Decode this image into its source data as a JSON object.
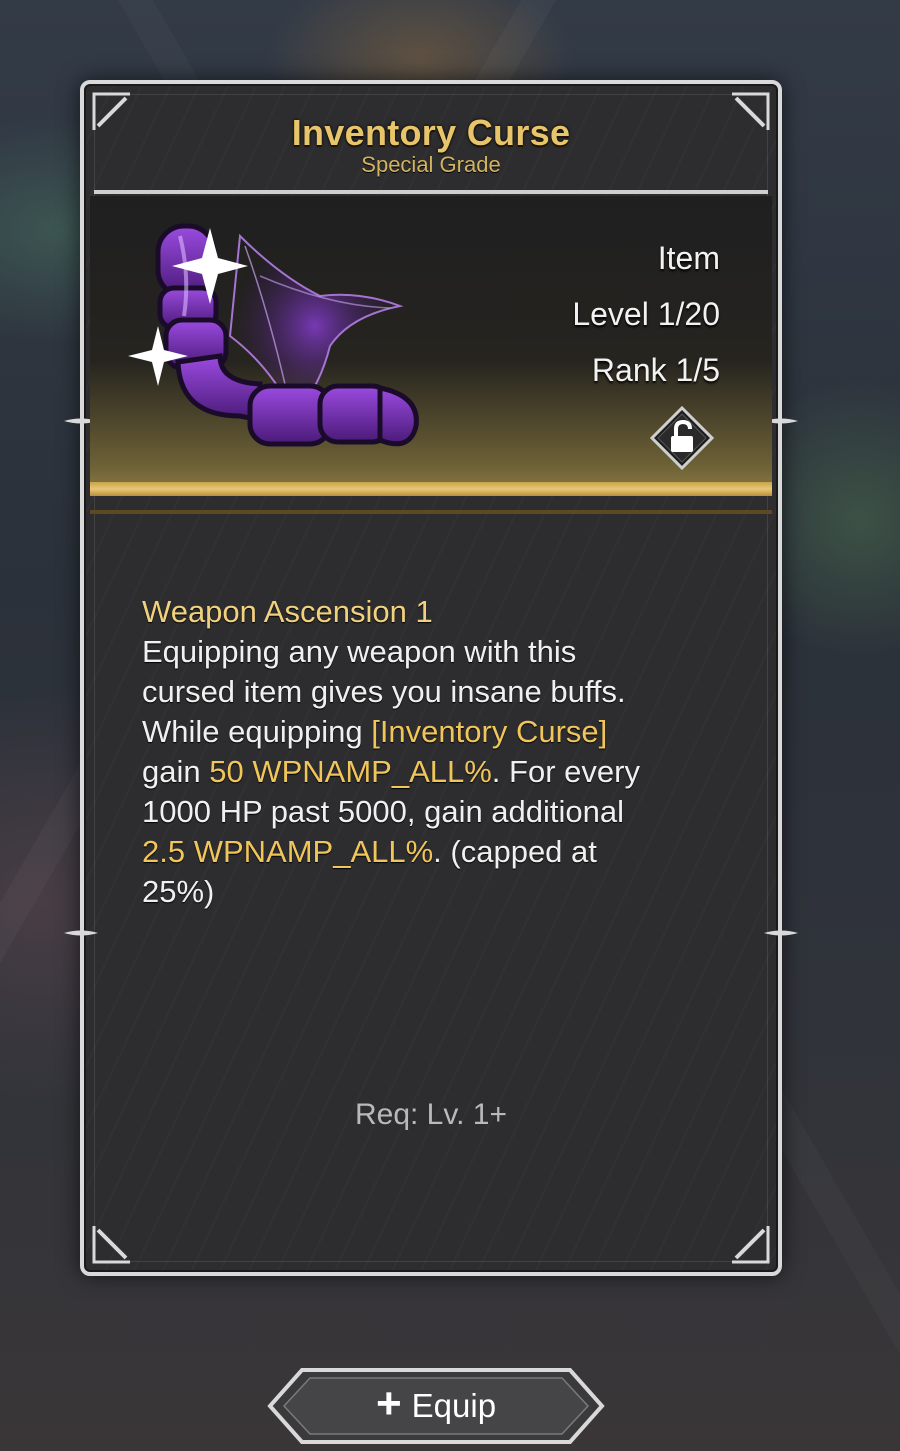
{
  "item": {
    "name": "Inventory Curse",
    "grade": "Special Grade",
    "type": "Item",
    "level": "Level 1/20",
    "rank": "Rank 1/5",
    "lock_icon": "unlocked-padlock-icon"
  },
  "description": {
    "title": "Weapon Ascension 1",
    "line1": "Equipping any weapon with this",
    "line2": "cursed item gives you insane buffs.",
    "line3_pre": "While equipping ",
    "line3_hl": "[Inventory Curse]",
    "line4_pre": "gain ",
    "line4_hl": "50 WPNAMP_ALL%",
    "line4_post": ". For every",
    "line5": "1000 HP past 5000, gain additional",
    "line6_hl": "2.5 WPNAMP_ALL%",
    "line6_post": ". (capped at",
    "line7": "25%)"
  },
  "requirement": "Req: Lv. 1+",
  "equip_button": {
    "icon": "plus-icon",
    "label": "Equip"
  },
  "colors": {
    "title_gold": "#e8c46a",
    "highlight_gold": "#f0c55a",
    "item_purple": "#7a2fc0",
    "card_bg": "#2d2d2f",
    "frame": "#d9d9d9"
  }
}
